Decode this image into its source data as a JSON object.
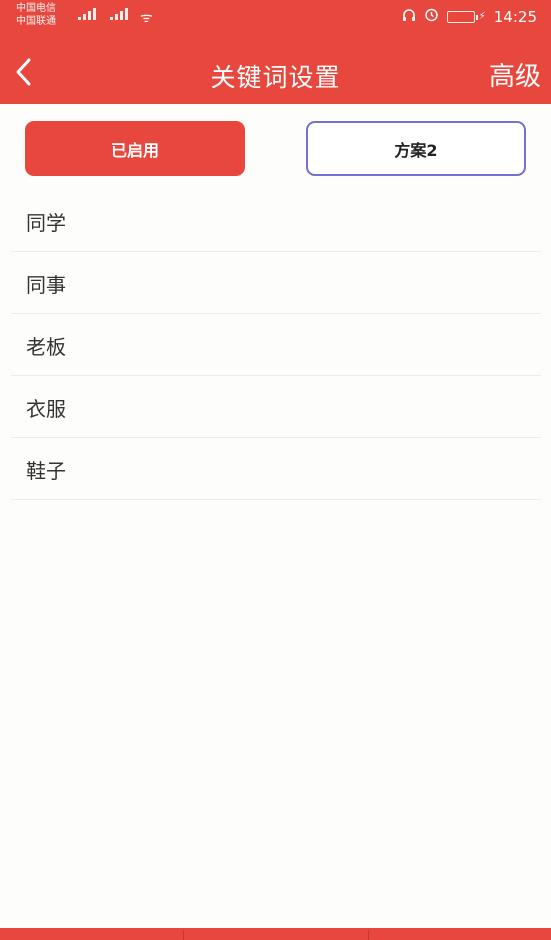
{
  "status_bar": {
    "carrier_line1": "中国电信",
    "carrier_line2": "中国联通",
    "time": "14:25",
    "battery_label": "95"
  },
  "nav": {
    "back_icon": "chevron-left-icon",
    "title": "关键词设置",
    "right_action": "高级"
  },
  "buttons": {
    "enabled_label": "已启用",
    "plan_label": "方案2"
  },
  "keywords": [
    "同学",
    "同事",
    "老板",
    "衣服",
    "鞋子"
  ],
  "colors": {
    "primary": "#e8473d",
    "plan_border": "#7270d3",
    "background": "#fdfdfb"
  }
}
